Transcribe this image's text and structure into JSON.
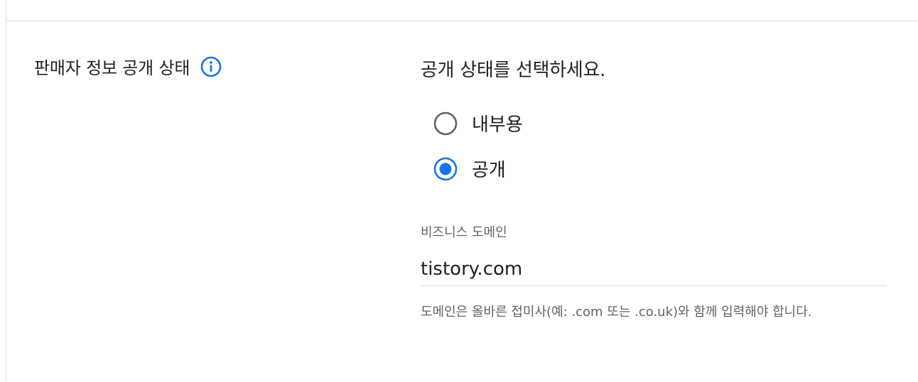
{
  "section": {
    "label": "판매자 정보 공개 상태",
    "info_icon": "info-icon"
  },
  "visibility": {
    "prompt": "공개 상태를 선택하세요.",
    "options": [
      {
        "label": "내부용",
        "selected": false
      },
      {
        "label": "공개",
        "selected": true
      }
    ]
  },
  "domain_field": {
    "label": "비즈니스 도메인",
    "value": "tistory.com",
    "helper": "도메인은 올바른 접미사(예: .com 또는 .co.uk)와 함께 입력해야 합니다."
  },
  "colors": {
    "accent": "#1a73e8",
    "text": "#202124",
    "secondary_text": "#5f6368",
    "divider": "#dadce0",
    "radio_unselected": "#5f6368"
  }
}
